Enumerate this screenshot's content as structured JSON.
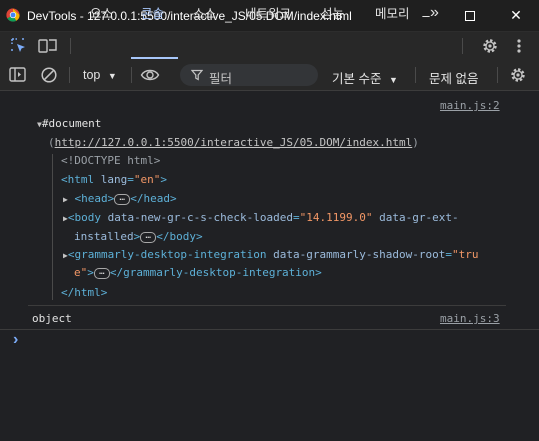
{
  "window": {
    "title": "DevTools - 127.0.0.1:5500/interactive_JS/05.DOM/index.html",
    "minimize": "–",
    "maximize": "☐",
    "close": "✕"
  },
  "tabs": [
    {
      "label": "요소"
    },
    {
      "label": "콘솔"
    },
    {
      "label": "소스"
    },
    {
      "label": "네트워크"
    },
    {
      "label": "성능"
    },
    {
      "label": "메모리"
    }
  ],
  "tabs_more": "»",
  "toolbar": {
    "context": "top",
    "filter_placeholder": "필터",
    "levels": "기본 수준",
    "issues": "문제 없음"
  },
  "console": {
    "entry1_source": "main.js:2",
    "doc_label": "#document",
    "doc_url": "http://127.0.0.1:5500/interactive_JS/05.DOM/index.html",
    "doctype": "<!DOCTYPE html>",
    "html_open_tag": "<html",
    "html_attr": "lang",
    "html_attr_val": "\"en\"",
    "head_open": "<head>",
    "head_close": "</head>",
    "body_open": "<body",
    "body_attr1": "data-new-gr-c-s-check-loaded",
    "body_attr1_val": "\"14.1199.0\"",
    "body_attr2_a": "data-gr-ext-",
    "body_attr2_b": "installed",
    "body_close": "</body>",
    "gram_open": "<grammarly-desktop-integration",
    "gram_attr": "data-grammarly-shadow-root",
    "gram_val_a": "\"tru",
    "gram_val_b": "e\"",
    "gram_close": "</grammarly-desktop-integration>",
    "html_close": "</html>",
    "entry2_text": "object",
    "entry2_source": "main.js:3",
    "prompt": "›"
  }
}
